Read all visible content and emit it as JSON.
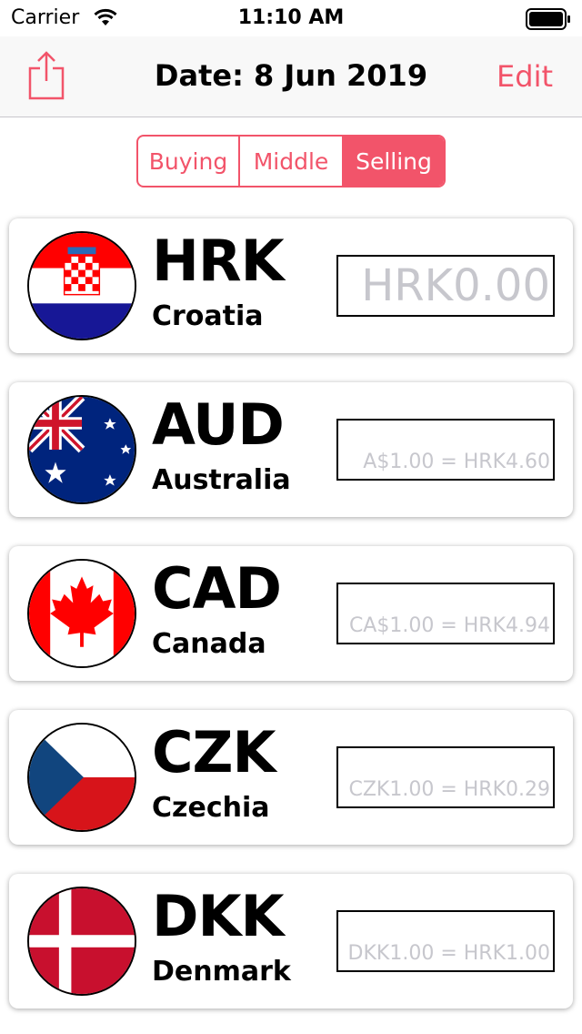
{
  "status_bar": {
    "carrier": "Carrier",
    "time": "11:10 AM"
  },
  "nav": {
    "title": "Date: 8 Jun 2019",
    "edit_label": "Edit",
    "share_icon": "share-icon"
  },
  "accent_color": "#f2546a",
  "segments": [
    {
      "label": "Buying",
      "selected": false
    },
    {
      "label": "Middle",
      "selected": false
    },
    {
      "label": "Selling",
      "selected": true
    }
  ],
  "currencies": [
    {
      "code": "HRK",
      "country": "Croatia",
      "rate_text": "HRK0.00",
      "flag_icon": "croatia-flag-icon"
    },
    {
      "code": "AUD",
      "country": "Australia",
      "rate_text": "A$1.00 = HRK4.60",
      "flag_icon": "australia-flag-icon"
    },
    {
      "code": "CAD",
      "country": "Canada",
      "rate_text": "CA$1.00 = HRK4.94",
      "flag_icon": "canada-flag-icon"
    },
    {
      "code": "CZK",
      "country": "Czechia",
      "rate_text": "CZK1.00 = HRK0.29",
      "flag_icon": "czechia-flag-icon"
    },
    {
      "code": "DKK",
      "country": "Denmark",
      "rate_text": "DKK1.00 = HRK1.00",
      "flag_icon": "denmark-flag-icon"
    }
  ]
}
